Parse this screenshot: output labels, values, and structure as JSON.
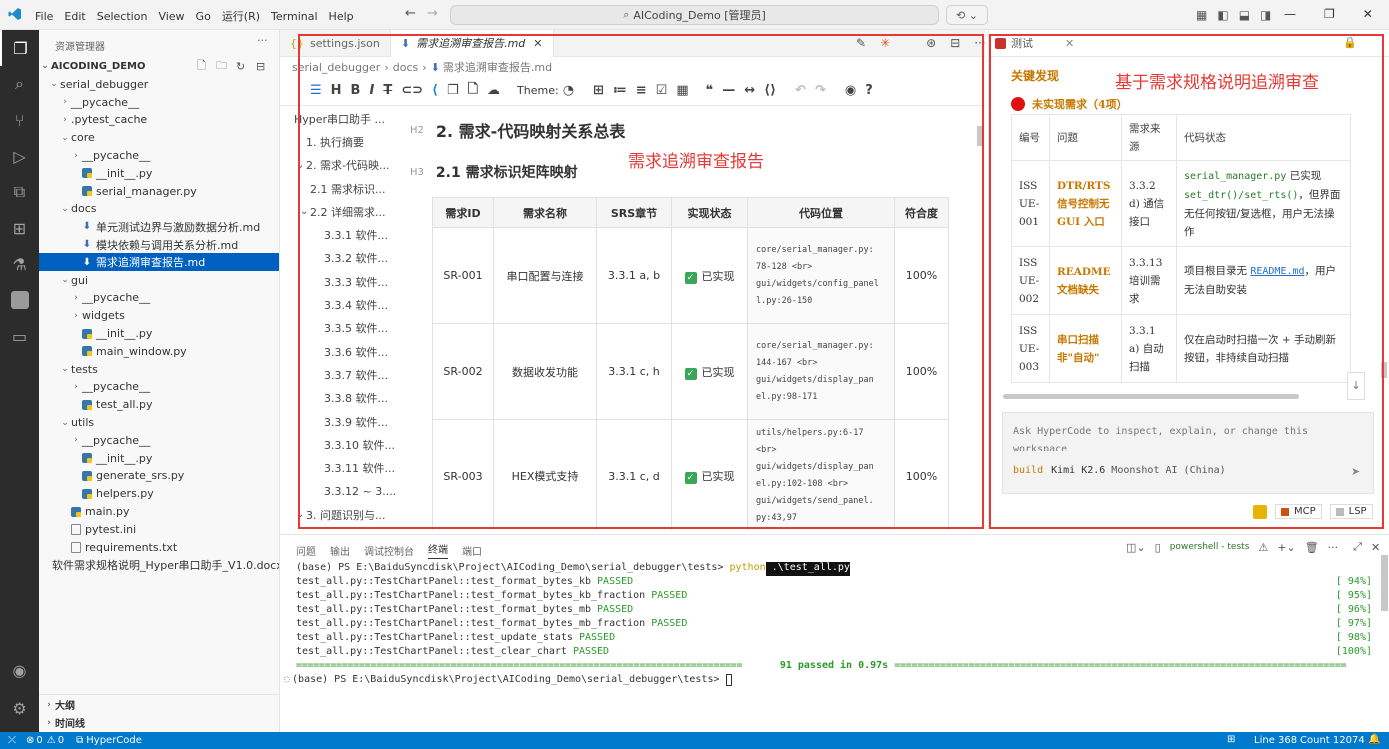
{
  "titlebar": {
    "menus": [
      "File",
      "Edit",
      "Selection",
      "View",
      "Go",
      "运行(R)",
      "Terminal",
      "Help"
    ],
    "command_center": "AICoding_Demo [管理员]"
  },
  "sidebar": {
    "title": "资源管理器",
    "root": "AICODING_DEMO",
    "tree": [
      {
        "label": "serial_debugger",
        "indent": 1,
        "kind": "folder",
        "open": true
      },
      {
        "label": "__pycache__",
        "indent": 2,
        "kind": "folder",
        "open": false
      },
      {
        "label": ".pytest_cache",
        "indent": 2,
        "kind": "folder",
        "open": false
      },
      {
        "label": "core",
        "indent": 2,
        "kind": "folder",
        "open": true
      },
      {
        "label": "__pycache__",
        "indent": 3,
        "kind": "folder",
        "open": false
      },
      {
        "label": "__init__.py",
        "indent": 3,
        "kind": "py"
      },
      {
        "label": "serial_manager.py",
        "indent": 3,
        "kind": "py"
      },
      {
        "label": "docs",
        "indent": 2,
        "kind": "folder",
        "open": true
      },
      {
        "label": "单元测试边界与激励数据分析.md",
        "indent": 3,
        "kind": "md"
      },
      {
        "label": "模块依赖与调用关系分析.md",
        "indent": 3,
        "kind": "md"
      },
      {
        "label": "需求追溯审查报告.md",
        "indent": 3,
        "kind": "md",
        "selected": true
      },
      {
        "label": "gui",
        "indent": 2,
        "kind": "folder",
        "open": true
      },
      {
        "label": "__pycache__",
        "indent": 3,
        "kind": "folder",
        "open": false
      },
      {
        "label": "widgets",
        "indent": 3,
        "kind": "folder",
        "open": false
      },
      {
        "label": "__init__.py",
        "indent": 3,
        "kind": "py"
      },
      {
        "label": "main_window.py",
        "indent": 3,
        "kind": "py"
      },
      {
        "label": "tests",
        "indent": 2,
        "kind": "folder",
        "open": true
      },
      {
        "label": "__pycache__",
        "indent": 3,
        "kind": "folder",
        "open": false
      },
      {
        "label": "test_all.py",
        "indent": 3,
        "kind": "py"
      },
      {
        "label": "utils",
        "indent": 2,
        "kind": "folder",
        "open": true
      },
      {
        "label": "__pycache__",
        "indent": 3,
        "kind": "folder",
        "open": false
      },
      {
        "label": "__init__.py",
        "indent": 3,
        "kind": "py"
      },
      {
        "label": "generate_srs.py",
        "indent": 3,
        "kind": "py"
      },
      {
        "label": "helpers.py",
        "indent": 3,
        "kind": "py"
      },
      {
        "label": "main.py",
        "indent": 2,
        "kind": "py"
      },
      {
        "label": "pytest.ini",
        "indent": 2,
        "kind": "file"
      },
      {
        "label": "requirements.txt",
        "indent": 2,
        "kind": "file"
      },
      {
        "label": "软件需求规格说明_Hyper串口助手_V1.0.docx",
        "indent": 1,
        "kind": "docx"
      }
    ],
    "outline_label": "大纲",
    "timeline_label": "时间线"
  },
  "editor": {
    "tab_inactive": "settings.json",
    "tab_active": "需求追溯审查报告.md",
    "breadcrumb": [
      "serial_debugger",
      "docs",
      "需求追溯审查报告.md"
    ],
    "theme_label": "Theme:",
    "outline": [
      {
        "label": "Hyper串口助手 ...",
        "level": 0
      },
      {
        "label": "1. 执行摘要",
        "level": 1
      },
      {
        "label": "2. 需求-代码映...",
        "level": 1,
        "chev": true
      },
      {
        "label": "2.1 需求标识...",
        "level": 2
      },
      {
        "label": "2.2 详细需求...",
        "level": 2,
        "chev": true
      },
      {
        "label": "3.3.1 软件...",
        "level": 3
      },
      {
        "label": "3.3.2 软件...",
        "level": 3
      },
      {
        "label": "3.3.3 软件...",
        "level": 3
      },
      {
        "label": "3.3.4 软件...",
        "level": 3
      },
      {
        "label": "3.3.5 软件...",
        "level": 3
      },
      {
        "label": "3.3.6 软件...",
        "level": 3
      },
      {
        "label": "3.3.7 软件...",
        "level": 3
      },
      {
        "label": "3.3.8 软件...",
        "level": 3
      },
      {
        "label": "3.3.9 软件...",
        "level": 3
      },
      {
        "label": "3.3.10 软件...",
        "level": 3
      },
      {
        "label": "3.3.11 软件...",
        "level": 3
      },
      {
        "label": "3.3.12 ~ 3....",
        "level": 3
      },
      {
        "label": "3. 问题识别与...",
        "level": 1,
        "chev": true
      }
    ],
    "h2_mark": "H2",
    "h2": "2. 需求-代码映射关系总表",
    "h3_mark": "H3",
    "h3": "2.1 需求标识矩阵映射",
    "annotation": "需求追溯审查报告",
    "table_headers": [
      "需求ID",
      "需求名称",
      "SRS章节",
      "实现状态",
      "代码位置",
      "符合度"
    ],
    "table_rows": [
      {
        "id": "SR-001",
        "name": "串口配置与连接",
        "srs": "3.3.1 a, b",
        "status": "已实现",
        "code": [
          "core/serial_manager.py:",
          "78-128 <br>",
          "gui/widgets/config_panel",
          "l.py:26-150"
        ],
        "fit": "100%"
      },
      {
        "id": "SR-002",
        "name": "数据收发功能",
        "srs": "3.3.1 c, h",
        "status": "已实现",
        "code": [
          "core/serial_manager.py:",
          "144-167 <br>",
          "gui/widgets/display_pan",
          "el.py:98-171"
        ],
        "fit": "100%"
      },
      {
        "id": "SR-003",
        "name": "HEX模式支持",
        "srs": "3.3.1 c, d",
        "status": "已实现",
        "code": [
          "utils/helpers.py:6-17",
          "<br>",
          "gui/widgets/display_pan",
          "el.py:102-108 <br>",
          "gui/widgets/send_panel.",
          "py:43,97"
        ],
        "fit": "100%"
      }
    ]
  },
  "panel": {
    "tab_label": "测试",
    "heading": "关键发现",
    "annotation": "基于需求规格说明追溯审查",
    "unimplemented": "未实现需求（4项）",
    "status_color": "#e01010",
    "table_headers": [
      "编号",
      "问题",
      "需求来源",
      "代码状态"
    ],
    "issues": [
      {
        "id": "ISSUE-001",
        "problem": "DTR/RTS 信号控制无 GUI 入口",
        "source": "3.3.2 d) 通信接口",
        "code_status_code": "serial_manager.py",
        "code_status_1": " 已实现 ",
        "code_status_code2": "set_dtr()/set_rts()",
        "code_status_2": "，但界面无任何按钮/复选框，用户无法操作"
      },
      {
        "id": "ISSUE-002",
        "problem": "README 文档缺失",
        "source": "3.3.13 培训需求",
        "code_status_1": "项目根目录无 ",
        "code_status_link": "README.md",
        "code_status_2": "，用户无法自助安装"
      },
      {
        "id": "ISSUE-003",
        "problem": "串口扫描非\"自动\"",
        "source": "3.3.1 a) 自动扫描",
        "code_status_1": "仅在启动时扫描一次 + 手动刷新按钮，非持续自动扫描"
      }
    ],
    "chat_placeholder": "Ask HyperCode to inspect, explain, or change this workspace",
    "model_mode": "build",
    "model_name": "Kimi K2.6",
    "model_provider": "Moonshot AI (China)",
    "mcp_label": "MCP",
    "lsp_label": "LSP"
  },
  "terminal": {
    "tabs": [
      "问题",
      "输出",
      "调试控制台",
      "终端",
      "端口"
    ],
    "active_tab": "终端",
    "shell_label": "powershell - tests",
    "command_prompt": "(base) PS E:\\BaiduSyncdisk\\Project\\AICoding_Demo\\serial_debugger\\tests> ",
    "command_cmd": "python",
    "command_arg": " .\\test_all.py",
    "lines": [
      {
        "text": "test_all.py::TestChartPanel::test_format_bytes_kb ",
        "result": "PASSED",
        "pct": "[ 94%]"
      },
      {
        "text": "test_all.py::TestChartPanel::test_format_bytes_kb_fraction ",
        "result": "PASSED",
        "pct": "[ 95%]"
      },
      {
        "text": "test_all.py::TestChartPanel::test_format_bytes_mb ",
        "result": "PASSED",
        "pct": "[ 96%]"
      },
      {
        "text": "test_all.py::TestChartPanel::test_format_bytes_mb_fraction ",
        "result": "PASSED",
        "pct": "[ 97%]"
      },
      {
        "text": "test_all.py::TestChartPanel::test_update_stats ",
        "result": "PASSED",
        "pct": "[ 98%]"
      },
      {
        "text": "test_all.py::TestChartPanel::test_clear_chart ",
        "result": "PASSED",
        "pct": "[100%]"
      }
    ],
    "summary": " 91 passed in 0.97s ",
    "final_prompt": "(base) PS E:\\BaiduSyncdisk\\Project\\AICoding_Demo\\serial_debugger\\tests> "
  },
  "status": {
    "problems": "0",
    "warnings": "0",
    "extension": "HyperCode",
    "line": "Line 368",
    "count": "Count 12074"
  }
}
